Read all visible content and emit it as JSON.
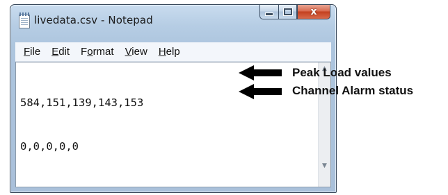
{
  "window": {
    "title": "livedata.csv - Notepad",
    "buttons": {
      "close_label": "x"
    }
  },
  "menu": {
    "items": [
      {
        "accel": "F",
        "rest": "ile"
      },
      {
        "accel": "E",
        "rest": "dit"
      },
      {
        "pre": "F",
        "accel": "o",
        "rest": "rmat"
      },
      {
        "accel": "V",
        "rest": "iew"
      },
      {
        "accel": "H",
        "rest": "elp"
      }
    ]
  },
  "editor": {
    "lines": [
      "584,151,139,143,153",
      "0,0,0,0,0"
    ]
  },
  "annotations": [
    {
      "label": "Peak Load values"
    },
    {
      "label": "Channel Alarm status"
    }
  ]
}
